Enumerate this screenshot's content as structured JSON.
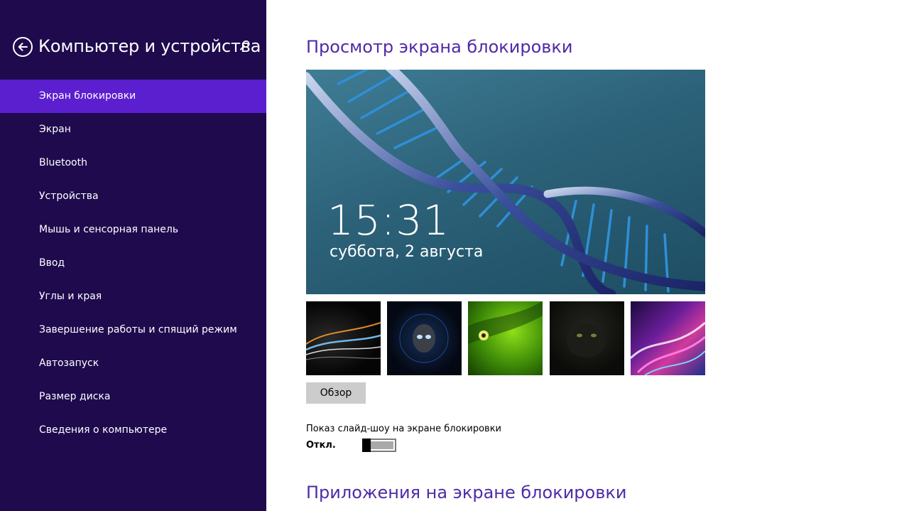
{
  "sidebar": {
    "title": "Компьютер и устройства",
    "back_icon": "back-arrow-icon",
    "search_icon": "search-icon",
    "items": [
      {
        "label": "Экран блокировки",
        "active": true
      },
      {
        "label": "Экран",
        "active": false
      },
      {
        "label": "Bluetooth",
        "active": false
      },
      {
        "label": "Устройства",
        "active": false
      },
      {
        "label": "Мышь и сенсорная панель",
        "active": false
      },
      {
        "label": "Ввод",
        "active": false
      },
      {
        "label": "Углы и края",
        "active": false
      },
      {
        "label": "Завершение работы и спящий режим",
        "active": false
      },
      {
        "label": "Автозапуск",
        "active": false
      },
      {
        "label": "Размер диска",
        "active": false
      },
      {
        "label": "Сведения о компьютере",
        "active": false
      }
    ]
  },
  "main": {
    "preview_title": "Просмотр экрана блокировки",
    "preview": {
      "time": "15:31",
      "date": "суббота, 2 августа"
    },
    "browse_label": "Обзор",
    "slideshow": {
      "label": "Показ слайд-шоу на экране блокировки",
      "state": "Откл.",
      "on": false
    },
    "apps_title": "Приложения на экране блокировки"
  },
  "colors": {
    "sidebar_bg": "#1f0a4e",
    "sidebar_active": "#5b1fd0",
    "accent_title": "#4f2aa8",
    "button_gray": "#cccccc"
  }
}
